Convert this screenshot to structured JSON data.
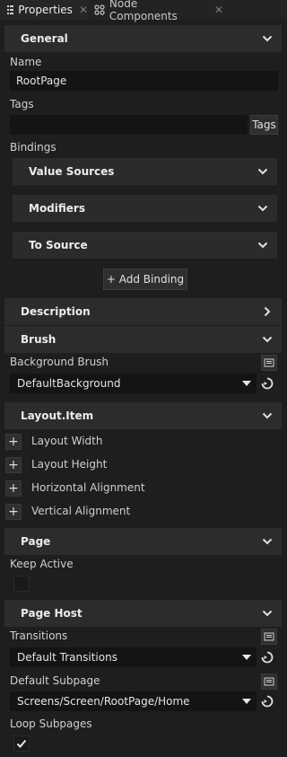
{
  "tabs": {
    "properties": "Properties",
    "node_components": "Node Components"
  },
  "sections": {
    "general": "General",
    "description": "Description",
    "brush": "Brush",
    "layout_item": "Layout.Item",
    "page": "Page",
    "page_host": "Page Host"
  },
  "general": {
    "name_label": "Name",
    "name_value": "RootPage",
    "tags_label": "Tags",
    "tags_value": "",
    "tags_button": "Tags",
    "bindings_label": "Bindings",
    "bindings": [
      "Value Sources",
      "Modifiers",
      "To Source"
    ],
    "add_binding": "+ Add Binding"
  },
  "brush": {
    "background_label": "Background Brush",
    "background_value": "DefaultBackground"
  },
  "layout_item": {
    "properties": [
      "Layout Width",
      "Layout Height",
      "Horizontal Alignment",
      "Vertical Alignment"
    ]
  },
  "page": {
    "keep_active_label": "Keep Active",
    "keep_active_checked": false
  },
  "page_host": {
    "transitions_label": "Transitions",
    "transitions_value": "Default Transitions",
    "default_subpage_label": "Default Subpage",
    "default_subpage_value": "Screens/Screen/RootPage/Home",
    "loop_subpages_label": "Loop Subpages",
    "loop_subpages_checked": true
  }
}
